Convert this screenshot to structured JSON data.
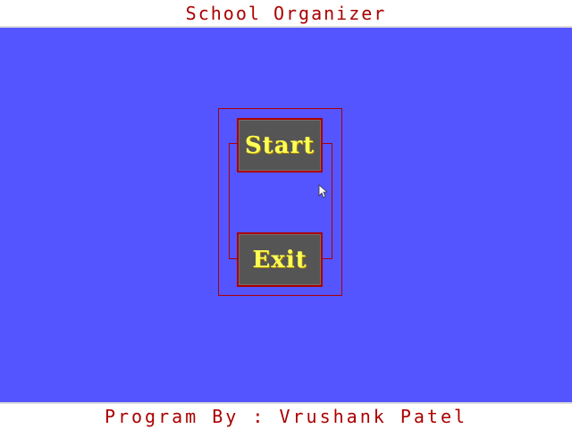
{
  "window": {
    "title": "School Organizer"
  },
  "menu": {
    "start_label": "Start",
    "exit_label": "Exit"
  },
  "footer": {
    "credit": "Program By : Vrushank Patel"
  },
  "colors": {
    "background": "#5555ff",
    "bar": "#ffffff",
    "text_red": "#aa0000",
    "button_face": "#555555",
    "button_text": "#ffff55"
  },
  "icons": {
    "pointer": "mouse-pointer-icon"
  }
}
